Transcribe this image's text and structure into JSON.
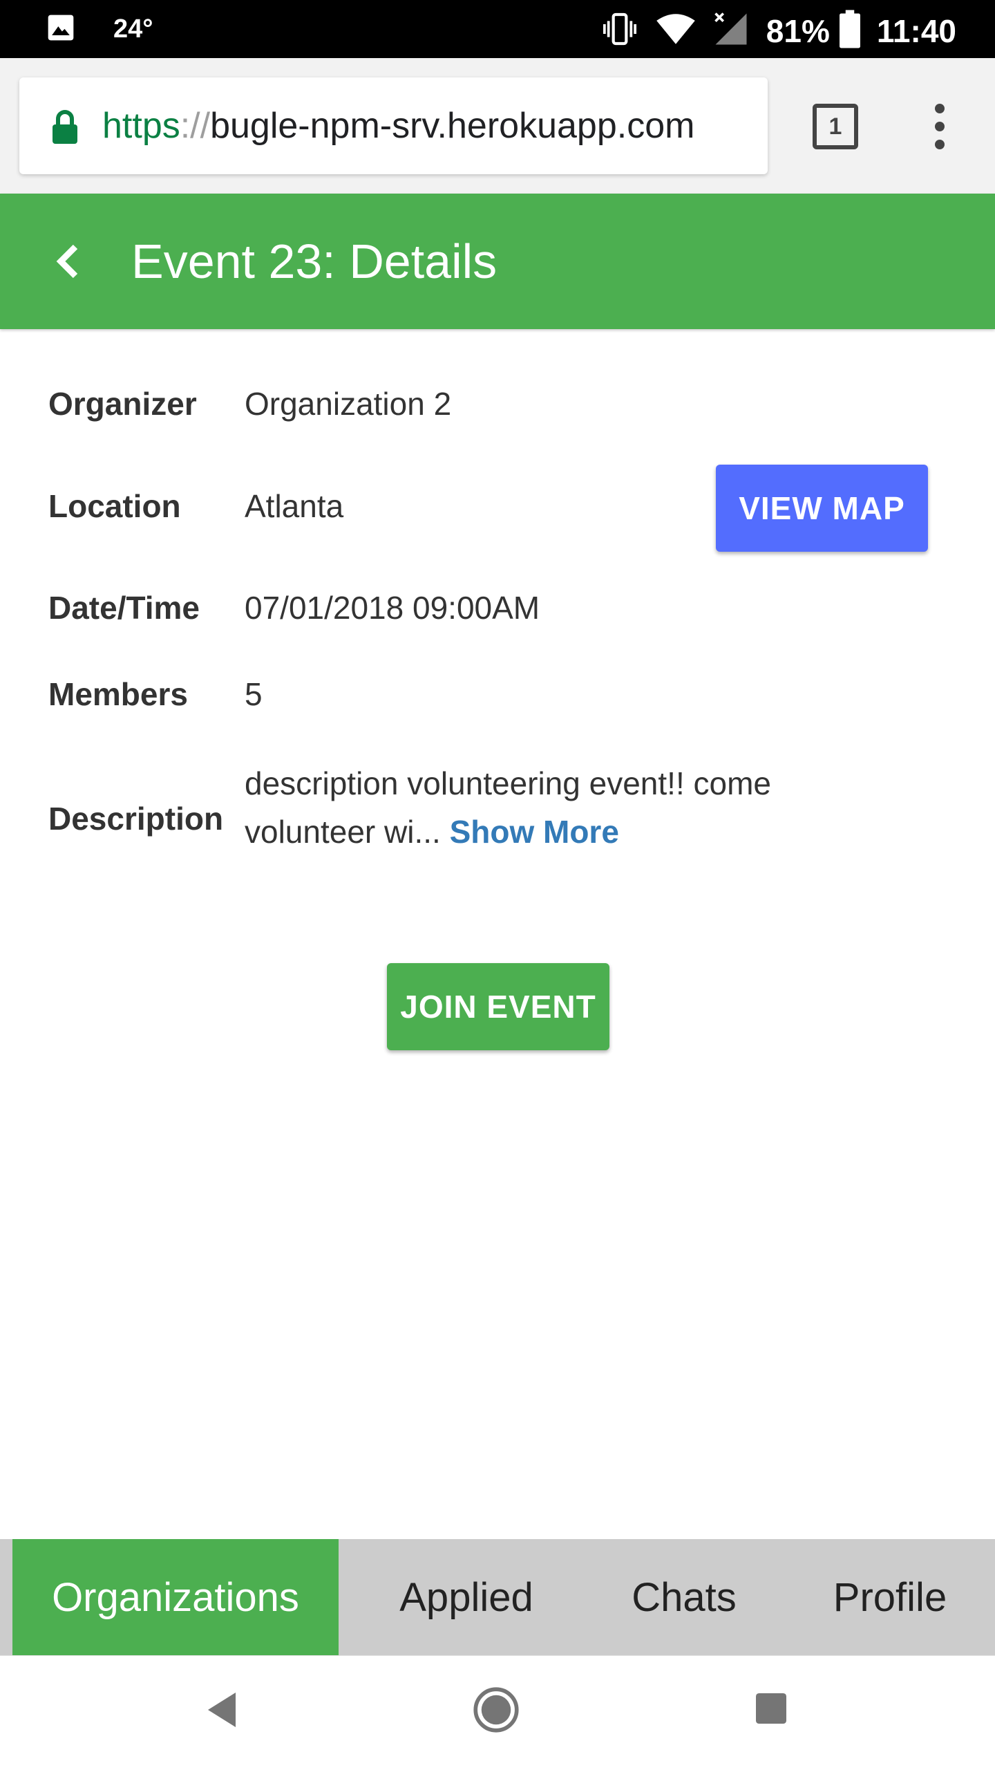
{
  "status_bar": {
    "temperature": "24°",
    "battery": "81%",
    "time": "11:40"
  },
  "browser": {
    "url_scheme": "https",
    "url_separator": "://",
    "url_host": "bugle-npm-srv.herokuapp.com",
    "tab_count": "1"
  },
  "header": {
    "title": "Event 23: Details"
  },
  "details": {
    "organizer_label": "Organizer",
    "organizer_value": "Organization 2",
    "location_label": "Location",
    "location_value": "Atlanta",
    "view_map_label": "VIEW MAP",
    "datetime_label": "Date/Time",
    "datetime_value": "07/01/2018 09:00AM",
    "members_label": "Members",
    "members_value": "5",
    "description_label": "Description",
    "description_value": "description volunteering event!! come volunteer wi...",
    "show_more_label": "Show More"
  },
  "actions": {
    "join_label": "JOIN EVENT"
  },
  "tabs": [
    {
      "label": "Organizations",
      "active": true
    },
    {
      "label": "Applied",
      "active": false
    },
    {
      "label": "Chats",
      "active": false
    },
    {
      "label": "Profile",
      "active": false
    }
  ],
  "colors": {
    "primary_green": "#4caf50",
    "view_map_blue": "#536dfe",
    "link_blue": "#337ab7",
    "tab_bar_grey": "#cccccc"
  }
}
